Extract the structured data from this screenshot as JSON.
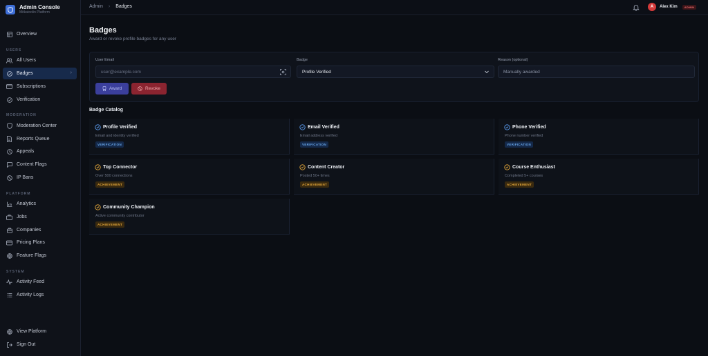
{
  "brand": {
    "title": "Admin Console",
    "subtitle": "Mitkatoolin Platform"
  },
  "sidebar": {
    "overview": "Overview",
    "sections": {
      "users": "USERS",
      "moderation": "MODERATION",
      "platform": "PLATFORM",
      "system": "SYSTEM"
    },
    "items": {
      "all_users": "All Users",
      "badges": "Badges",
      "subscriptions": "Subscriptions",
      "verification": "Verification",
      "moderation_center": "Moderation Center",
      "reports_queue": "Reports Queue",
      "appeals": "Appeals",
      "content_flags": "Content Flags",
      "ip_bans": "IP Bans",
      "analytics": "Analytics",
      "jobs": "Jobs",
      "companies": "Companies",
      "pricing_plans": "Pricing Plans",
      "feature_flags": "Feature Flags",
      "activity_feed": "Activity Feed",
      "activity_logs": "Activity Logs",
      "view_platform": "View Platform",
      "sign_out": "Sign Out"
    }
  },
  "header": {
    "breadcrumb": {
      "root": "Admin",
      "current": "Badges"
    },
    "user": {
      "initial": "A",
      "name": "Alex Kim",
      "role": "ADMIN"
    }
  },
  "page": {
    "title": "Badges",
    "subtitle": "Award or revoke profile badges for any user"
  },
  "form": {
    "email_label": "User Email",
    "email_placeholder": "user@example.com",
    "badge_label": "Badge",
    "badge_selected": "Profile Verified",
    "reason_label": "Reason (optional)",
    "reason_value": "Manually awarded",
    "award_label": "Award",
    "revoke_label": "Revoke"
  },
  "catalog": {
    "title": "Badge Catalog",
    "badges": [
      {
        "name": "Profile Verified",
        "desc": "Email and identity verified",
        "tag": "VERIFICATION"
      },
      {
        "name": "Email Verified",
        "desc": "Email address verified",
        "tag": "VERIFICATION"
      },
      {
        "name": "Phone Verified",
        "desc": "Phone number verified",
        "tag": "VERIFICATION"
      },
      {
        "name": "Top Connector",
        "desc": "Over 500 connections",
        "tag": "ACHIEVEMENT"
      },
      {
        "name": "Content Creator",
        "desc": "Posted 50+ times",
        "tag": "ACHIEVEMENT"
      },
      {
        "name": "Course Enthusiast",
        "desc": "Completed 5+ courses",
        "tag": "ACHIEVEMENT"
      },
      {
        "name": "Community Champion",
        "desc": "Active community contributor",
        "tag": "ACHIEVEMENT"
      }
    ]
  },
  "colors": {
    "accent": "#3e6fd8",
    "verification": "#5b9cf0",
    "achievement": "#e7a93b",
    "award": "#3b3f9c",
    "revoke": "#8b2430"
  }
}
